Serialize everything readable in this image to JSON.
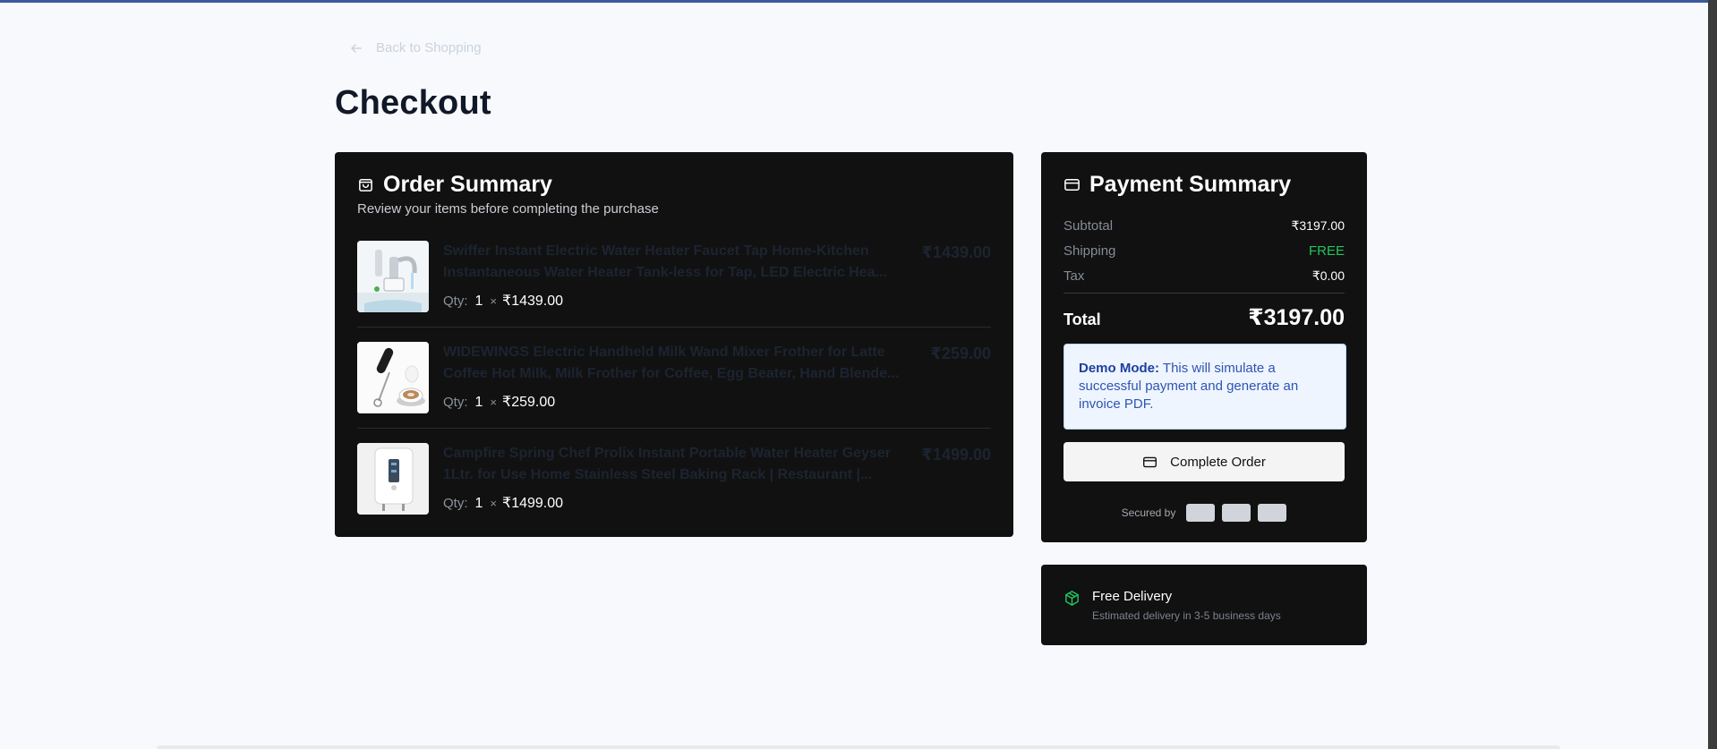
{
  "nav": {
    "back_label": "Back to Shopping"
  },
  "page": {
    "title": "Checkout"
  },
  "order_summary": {
    "title": "Order Summary",
    "subtitle": "Review your items before completing the purchase",
    "items": [
      {
        "name_line1": "Swiffer Instant Electric Water Heater Faucet Tap Home-Kitchen",
        "name_line2": "Instantaneous Water Heater Tank-less for Tap, LED Electric Hea...",
        "price": "₹1439.00",
        "qty_label": "Qty:",
        "qty": "1",
        "times": "×",
        "unit_price": "₹1439.00",
        "thumb_icon": "faucet-product-image"
      },
      {
        "name_line1": "WIDEWINGS Electric Handheld Milk Wand Mixer Frother for Latte",
        "name_line2": "Coffee Hot Milk, Milk Frother for Coffee, Egg Beater, Hand Blende...",
        "price": "₹259.00",
        "qty_label": "Qty:",
        "qty": "1",
        "times": "×",
        "unit_price": "₹259.00",
        "thumb_icon": "frother-product-image"
      },
      {
        "name_line1": "Campfire Spring Chef Prolix Instant Portable Water Heater Geyser",
        "name_line2": "1Ltr. for Use Home Stainless Steel Baking Rack | Restaurant |...",
        "price": "₹1499.00",
        "qty_label": "Qty:",
        "qty": "1",
        "times": "×",
        "unit_price": "₹1499.00",
        "thumb_icon": "geyser-product-image"
      }
    ]
  },
  "payment_summary": {
    "title": "Payment Summary",
    "subtotal_label": "Subtotal",
    "subtotal": "₹3197.00",
    "shipping_label": "Shipping",
    "shipping": "FREE",
    "tax_label": "Tax",
    "tax": "₹0.00",
    "total_label": "Total",
    "total": "₹3197.00",
    "demo_title": "Demo Mode:",
    "demo_text": "This will simulate a successful payment and generate an invoice PDF.",
    "complete_label": "Complete Order",
    "secured_label": "Secured by"
  },
  "delivery": {
    "title": "Free Delivery",
    "subtitle": "Estimated delivery in 3-5 business days"
  },
  "colors": {
    "card_bg": "#111111",
    "page_bg": "#f7f9fc",
    "free_green": "#22c55e",
    "demo_blue": "#2f54b4"
  }
}
